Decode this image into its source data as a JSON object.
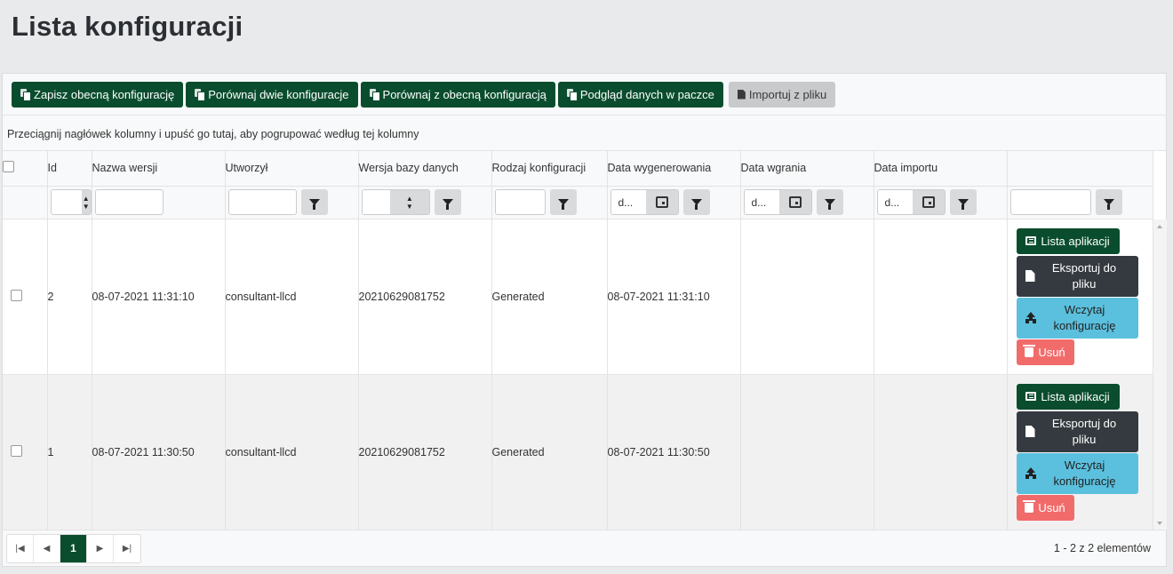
{
  "page": {
    "title": "Lista konfiguracji"
  },
  "toolbar": {
    "buttons": [
      {
        "label": "Zapisz obecną konfigurację",
        "icon": "copy-icon"
      },
      {
        "label": "Porównaj dwie konfiguracje",
        "icon": "copy-icon"
      },
      {
        "label": "Porównaj z obecną konfiguracją",
        "icon": "copy-icon"
      },
      {
        "label": "Podgląd danych w paczce",
        "icon": "copy-icon"
      },
      {
        "label": "Importuj z pliku",
        "icon": "file-import-icon",
        "disabled": true
      }
    ]
  },
  "group_hint": "Przeciągnij nagłówek kolumny i upuść go tutaj, aby pogrupować według tej kolumny",
  "columns": [
    "",
    "Id",
    "Nazwa wersji",
    "Utworzył",
    "Wersja bazy danych",
    "Rodzaj konfiguracji",
    "Data wygenerowania",
    "Data wgrania",
    "Data importu",
    ""
  ],
  "filters": {
    "date_placeholder": "d..."
  },
  "rows": [
    {
      "id": "2",
      "name": "08-07-2021 11:31:10",
      "created_by": "consultant-llcd",
      "db_version": "20210629081752",
      "type": "Generated",
      "generated": "08-07-2021 11:31:10",
      "uploaded": "",
      "imported": ""
    },
    {
      "id": "1",
      "name": "08-07-2021 11:30:50",
      "created_by": "consultant-llcd",
      "db_version": "20210629081752",
      "type": "Generated",
      "generated": "08-07-2021 11:30:50",
      "uploaded": "",
      "imported": ""
    }
  ],
  "actions": {
    "list": "Lista aplikacji",
    "export": "Eksportuj do pliku",
    "load": "Wczytaj konfigurację",
    "delete": "Usuń"
  },
  "pager": {
    "current_page": "1",
    "info": "1 - 2 z 2 elementów",
    "first": "first-page-icon",
    "prev": "prev-page-icon",
    "next": "next-page-icon",
    "last": "last-page-icon"
  },
  "colors": {
    "primary": "#0a4d2e",
    "dark": "#343a40",
    "info": "#5bc0de",
    "danger": "#f26b6b"
  }
}
